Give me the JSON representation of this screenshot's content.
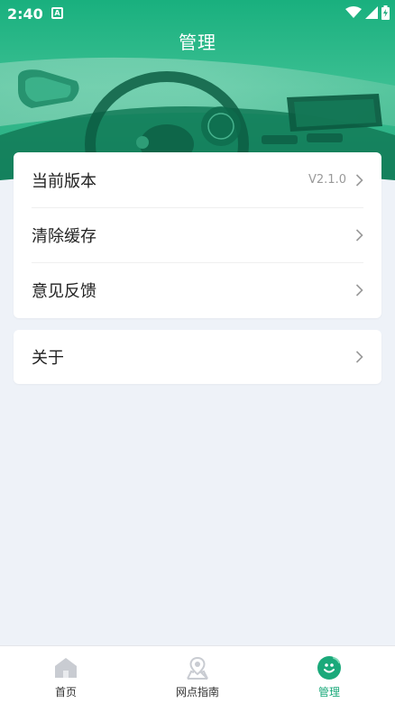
{
  "status_bar": {
    "time": "2:40",
    "app_icon": "A"
  },
  "header": {
    "title": "管理"
  },
  "settings": {
    "items": [
      {
        "label": "当前版本",
        "value": "V2.1.0"
      },
      {
        "label": "清除缓存"
      },
      {
        "label": "意见反馈"
      }
    ],
    "about": {
      "label": "关于"
    }
  },
  "bottom_nav": {
    "items": [
      {
        "label": "首页",
        "icon": "home-icon"
      },
      {
        "label": "网点指南",
        "icon": "map-pin-icon"
      },
      {
        "label": "管理",
        "icon": "smile-icon",
        "active": true
      }
    ]
  },
  "colors": {
    "brand_green": "#1aa97a",
    "background": "#eef2f8"
  }
}
